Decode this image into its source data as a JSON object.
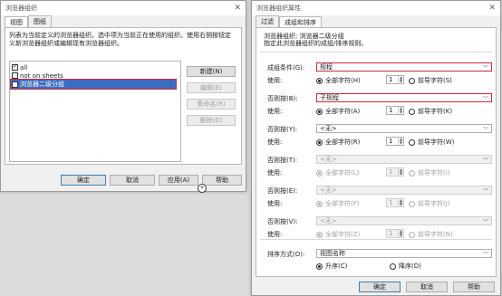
{
  "left_dialog": {
    "title": "浏览器组织",
    "tabs": [
      "视图",
      "图纸"
    ],
    "description": "列表为当前定义的浏览器组织。选中项为当前正在使用的组织。使用右侧按钮定义新浏览器组织或编辑现有浏览器组织。",
    "list_items": [
      {
        "label": "all",
        "checked": true,
        "selected": false
      },
      {
        "label": "not on sheets",
        "checked": false,
        "selected": false
      },
      {
        "label": "浏览器二级分组",
        "checked": false,
        "selected": true
      }
    ],
    "side_buttons": [
      "新建(N)",
      "编辑(E)",
      "重命名(R)",
      "删除(D)"
    ],
    "bottom_buttons": [
      "确定",
      "取消",
      "应用(A)",
      "帮助"
    ]
  },
  "right_dialog": {
    "title": "浏览器组织属性",
    "tabs": [
      "过滤",
      "成组和排序"
    ],
    "heading_line1": "浏览器组织: 浏览器二级分组",
    "heading_line2": "指定此浏览器组织的成组/排序规则。",
    "use_label": "使用:",
    "all_chars": "全部字符",
    "prefix_chars": "前导字符",
    "groups": [
      {
        "label": "成组条件(G):",
        "value": "规程",
        "enabled": true,
        "highlight": true,
        "count": "1",
        "all_key": "(H)",
        "pre_key": "(S)"
      },
      {
        "label": "否则按(B):",
        "value": "子规程",
        "enabled": true,
        "highlight": true,
        "count": "1",
        "all_key": "(A)",
        "pre_key": "(K)"
      },
      {
        "label": "否则按(Y):",
        "value": "<无>",
        "enabled": true,
        "highlight": false,
        "count": "1",
        "all_key": "(R)",
        "pre_key": "(W)"
      },
      {
        "label": "否则按(T):",
        "value": "<无>",
        "enabled": false,
        "highlight": false,
        "count": "1",
        "all_key": "(L)",
        "pre_key": "(I)"
      },
      {
        "label": "否则按(E):",
        "value": "<无>",
        "enabled": false,
        "highlight": false,
        "count": "1",
        "all_key": "(F)",
        "pre_key": "(J)"
      },
      {
        "label": "否则按(V):",
        "value": "<无>",
        "enabled": false,
        "highlight": false,
        "count": "1",
        "all_key": "(Z)",
        "pre_key": "(N)"
      }
    ],
    "sort_label": "排序方式(O):",
    "sort_value": "视图名称",
    "asc_label": "升序(C)",
    "desc_label": "降序(D)",
    "bottom_buttons": [
      "确定",
      "取消",
      "帮助"
    ]
  },
  "icons": {
    "close": "close-icon",
    "dropdown": "chevron-down-icon",
    "spin": "spinner-icon"
  },
  "colors": {
    "highlight": "#c82c3c",
    "selection": "#3c6cc0"
  }
}
